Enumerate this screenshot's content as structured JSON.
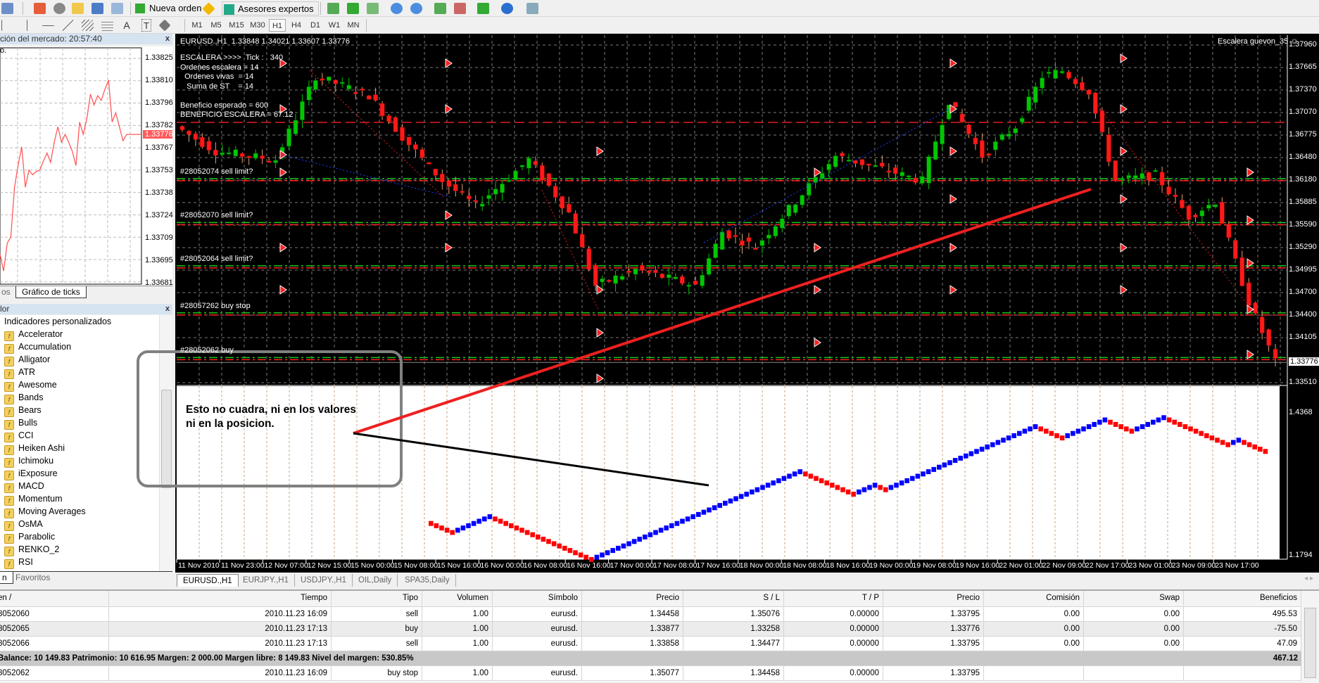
{
  "toolbar": {
    "new_order": "Nueva orden",
    "experts": "Asesores expertos",
    "timeframes": [
      "M1",
      "M5",
      "M15",
      "M30",
      "H1",
      "H4",
      "D1",
      "W1",
      "MN"
    ],
    "active_timeframe": "H1",
    "text_tool": "A",
    "label_tool": "T"
  },
  "market_watch": {
    "title": "ción del mercado: 20:57:40",
    "corner": "o.",
    "close": "x",
    "tabs": [
      "os",
      "Gráfico de ticks"
    ],
    "price_ticks": [
      "1.33825",
      "1.33810",
      "1.33796",
      "1.33782",
      "1.33767",
      "1.33753",
      "1.33738",
      "1.33724",
      "1.33709",
      "1.33695",
      "1.33681"
    ],
    "current_price": "1.33776",
    "ticks": [
      1.33699,
      1.33688,
      1.33706,
      1.3371,
      1.33742,
      1.33756,
      1.33768,
      1.33742,
      1.33753,
      1.3375,
      1.33752,
      1.33753,
      1.33759,
      1.33764,
      1.33758,
      1.33771,
      1.33781,
      1.33771,
      1.33776,
      1.33771,
      1.33765,
      1.33756,
      1.33784,
      1.33776,
      1.33786,
      1.33802,
      1.33795,
      1.33801,
      1.33798,
      1.33805,
      1.33811,
      1.33784,
      1.3379,
      1.33781,
      1.33772,
      1.33776,
      1.33776
    ]
  },
  "navigator": {
    "title": "lor",
    "close": "x",
    "group": "Indicadores personalizados",
    "items": [
      "Accelerator",
      "Accumulation",
      "Alligator",
      "ATR",
      "Awesome",
      "Bands",
      "Bears",
      "Bulls",
      "CCI",
      "Heiken Ashi",
      "Ichimoku",
      "iExposure",
      "MACD",
      "Momentum",
      "Moving Averages",
      "OsMA",
      "Parabolic",
      "RENKO_2",
      "RSI"
    ],
    "tabs": [
      "n",
      "Favoritos"
    ]
  },
  "chart": {
    "header": "EURUSD.,H1  1.33848 1.34021 1.33607 1.33776",
    "ea_name": "Escalera guevon_35 ☺",
    "info": [
      "ESCALERA >>>>  Tick :   340",
      "Ordenes escalera = 14",
      "  Ordenes vivas  = 14",
      "   Suma de ST    = 14",
      "",
      "Beneficio esperado = 600",
      "BENEFICIO ESCALERA = 67.12"
    ],
    "order_labels": [
      "#28052074 sell limit?",
      "#28052070 sell limit?",
      "#28052064 sell limit?",
      "#28057262 buy stop",
      "#28052062 buy"
    ],
    "annotation": [
      "Esto no cuadra, ni en los valores",
      "ni en la posicion."
    ],
    "renko_scale": [
      "1.4368",
      "1.1794"
    ],
    "tabs": [
      "EURUSD.,H1",
      "EURJPY.,H1",
      "USDJPY.,H1",
      "OIL,Daily",
      "SPA35,Daily"
    ],
    "colors": {
      "bull": "#00c800",
      "bear": "#ff1a1a",
      "renko_up": "#0000ff",
      "renko_down": "#ff0000",
      "bg": "#000000"
    }
  },
  "chart_data": {
    "type": "candlestick",
    "symbol": "EURUSD.",
    "timeframe": "H1",
    "ylim": [
      1.3351,
      1.3796
    ],
    "y_ticks": [
      "1.37960",
      "1.37665",
      "1.37370",
      "1.37070",
      "1.36775",
      "1.36480",
      "1.36180",
      "1.35885",
      "1.35590",
      "1.35290",
      "1.34995",
      "1.34700",
      "1.34400",
      "1.34105",
      "1.33776",
      "1.33510"
    ],
    "current_price": "1.33776",
    "x_ticks": [
      "11 Nov 2010",
      "11 Nov 23:00",
      "12 Nov 07:00",
      "12 Nov 15:00",
      "15 Nov 00:00",
      "15 Nov 08:00",
      "15 Nov 16:00",
      "16 Nov 00:00",
      "16 Nov 08:00",
      "16 Nov 16:00",
      "17 Nov 00:00",
      "17 Nov 08:00",
      "17 Nov 16:00",
      "18 Nov 00:00",
      "18 Nov 08:00",
      "18 Nov 16:00",
      "19 Nov 00:00",
      "19 Nov 08:00",
      "19 Nov 16:00",
      "22 Nov 01:00",
      "22 Nov 09:00",
      "22 Nov 17:00",
      "23 Nov 01:00",
      "23 Nov 09:00",
      "23 Nov 17:00"
    ],
    "price_path": [
      [
        0,
        1.3689
      ],
      [
        6,
        1.3656
      ],
      [
        15,
        1.3645
      ],
      [
        21,
        1.3755
      ],
      [
        29,
        1.373
      ],
      [
        34,
        1.3675
      ],
      [
        40,
        1.3617
      ],
      [
        45,
        1.3584
      ],
      [
        53,
        1.3645
      ],
      [
        59,
        1.3575
      ],
      [
        63,
        1.3479
      ],
      [
        69,
        1.35
      ],
      [
        78,
        1.3479
      ],
      [
        82,
        1.355
      ],
      [
        87,
        1.353
      ],
      [
        94,
        1.36
      ],
      [
        99,
        1.365
      ],
      [
        107,
        1.363
      ],
      [
        112,
        1.3617
      ],
      [
        116,
        1.3723
      ],
      [
        121,
        1.365
      ],
      [
        126,
        1.3689
      ],
      [
        130,
        1.3755
      ],
      [
        133,
        1.3762
      ],
      [
        137,
        1.3735
      ],
      [
        141,
        1.3617
      ],
      [
        147,
        1.3625
      ],
      [
        152,
        1.357
      ],
      [
        156,
        1.359
      ],
      [
        161,
        1.3457
      ],
      [
        165,
        1.3378
      ]
    ],
    "order_levels": [
      1.362,
      1.3562,
      1.3505,
      1.3443,
      1.3384
    ],
    "renko_runs": [
      [
        "down",
        5
      ],
      [
        "up",
        7
      ],
      [
        "down",
        19
      ],
      [
        "up",
        39
      ],
      [
        "down",
        10
      ],
      [
        "up",
        4
      ],
      [
        "down",
        2
      ],
      [
        "up",
        28
      ],
      [
        "down",
        5
      ],
      [
        "up",
        8
      ],
      [
        "down",
        5
      ],
      [
        "up",
        6
      ],
      [
        "down",
        12
      ],
      [
        "up",
        2
      ],
      [
        "down",
        5
      ]
    ]
  },
  "trade": {
    "columns": [
      "en  /",
      "Tiempo",
      "Tipo",
      "Volumen",
      "Símbolo",
      "Precio",
      "S / L",
      "T / P",
      "Precio",
      "Comisión",
      "Swap",
      "Beneficios"
    ],
    "rows": [
      [
        "8052060",
        "2010.11.23 16:09",
        "sell",
        "1.00",
        "eurusd.",
        "1.34458",
        "1.35076",
        "0.00000",
        "1.33795",
        "0.00",
        "0.00",
        "495.53"
      ],
      [
        "8052065",
        "2010.11.23 17:13",
        "buy",
        "1.00",
        "eurusd.",
        "1.33877",
        "1.33258",
        "0.00000",
        "1.33776",
        "0.00",
        "0.00",
        "-75.50"
      ],
      [
        "8052066",
        "2010.11.23 17:13",
        "sell",
        "1.00",
        "eurusd.",
        "1.33858",
        "1.34477",
        "0.00000",
        "1.33795",
        "0.00",
        "0.00",
        "47.09"
      ]
    ],
    "summary": "Balance: 10 149.83  Patrimonio: 10 616.95  Margen: 2 000.00  Margen libre: 8 149.83  Nivel del margen: 530.85%",
    "summary_total": "467.12",
    "pending": [
      "8052062",
      "2010.11.23 16:09",
      "buy stop",
      "1.00",
      "eurusd.",
      "1.35077",
      "1.34458",
      "0.00000",
      "1.33795",
      "",
      "",
      ""
    ]
  }
}
